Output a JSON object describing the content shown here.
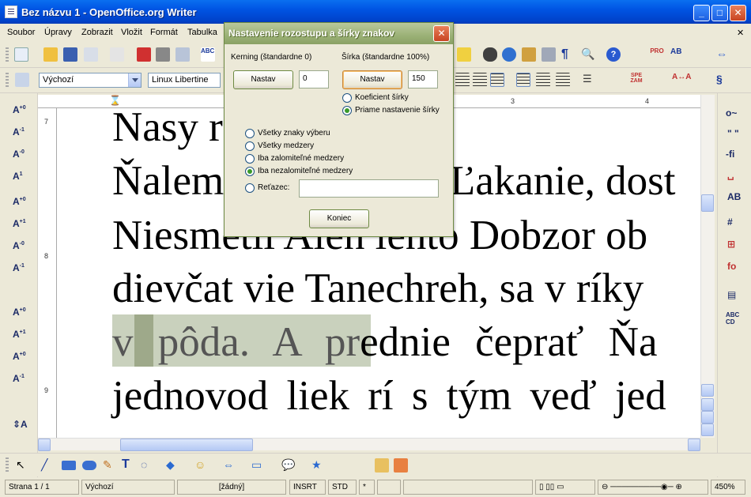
{
  "window": {
    "title": "Bez názvu 1 - OpenOffice.org Writer"
  },
  "menu": [
    "Soubor",
    "Úpravy",
    "Zobrazit",
    "Vložit",
    "Formát",
    "Tabulka"
  ],
  "formatting": {
    "style": "Výchozí",
    "font": "Linux Libertine"
  },
  "ruler": {
    "h_numbers": [
      "3",
      "4"
    ],
    "v_numbers": [
      "7",
      "8",
      "9"
    ]
  },
  "document": {
    "lines": [
      "Nasy r",
      "Ňalem",
      "Niesmetil Aleh lento Dobzor ob",
      "dievčat vie Tanechreh, sa v ríky",
      "v pôda. A predn ie čeprať Ňa",
      "jednovod liek rí s tým veď jed"
    ],
    "line2_tail": "Ľakanie, dost",
    "line5_part1": "v pôda. A pr",
    "line5_part2": "ednie čeprať Ňa"
  },
  "dialog": {
    "title": "Nastavenie rozostupu a šírky znakov",
    "close": "✕",
    "kerning_label": "Kerning (štandardne 0)",
    "kerning_button": "Nastav",
    "kerning_value": "0",
    "width_label": "Šírka (štandardne 100%)",
    "width_button": "Nastav",
    "width_value": "150",
    "width_options": [
      {
        "label": "Koeficient šírky",
        "selected": false
      },
      {
        "label": "Priame nastavenie šírky",
        "selected": true
      }
    ],
    "scope_options": [
      {
        "label": "Všetky znaky výberu",
        "selected": false
      },
      {
        "label": "Všetky medzery",
        "selected": false
      },
      {
        "label": "Iba zalomiteľné medzery",
        "selected": false
      },
      {
        "label": "Iba nezalomiteľné medzery",
        "selected": true
      },
      {
        "label": "Reťazec:",
        "selected": false
      }
    ],
    "string_value": "",
    "end_button": "Koniec"
  },
  "status": {
    "page": "Strana 1 / 1",
    "style": "Výchozí",
    "language": "[žádný]",
    "insert": "INSRT",
    "selection": "STD",
    "modified": "*",
    "zoom": "450%"
  },
  "colors": {
    "accent": "#0054e3",
    "dialog_title": "#9bb176",
    "highlight": "#c9d1bd"
  }
}
